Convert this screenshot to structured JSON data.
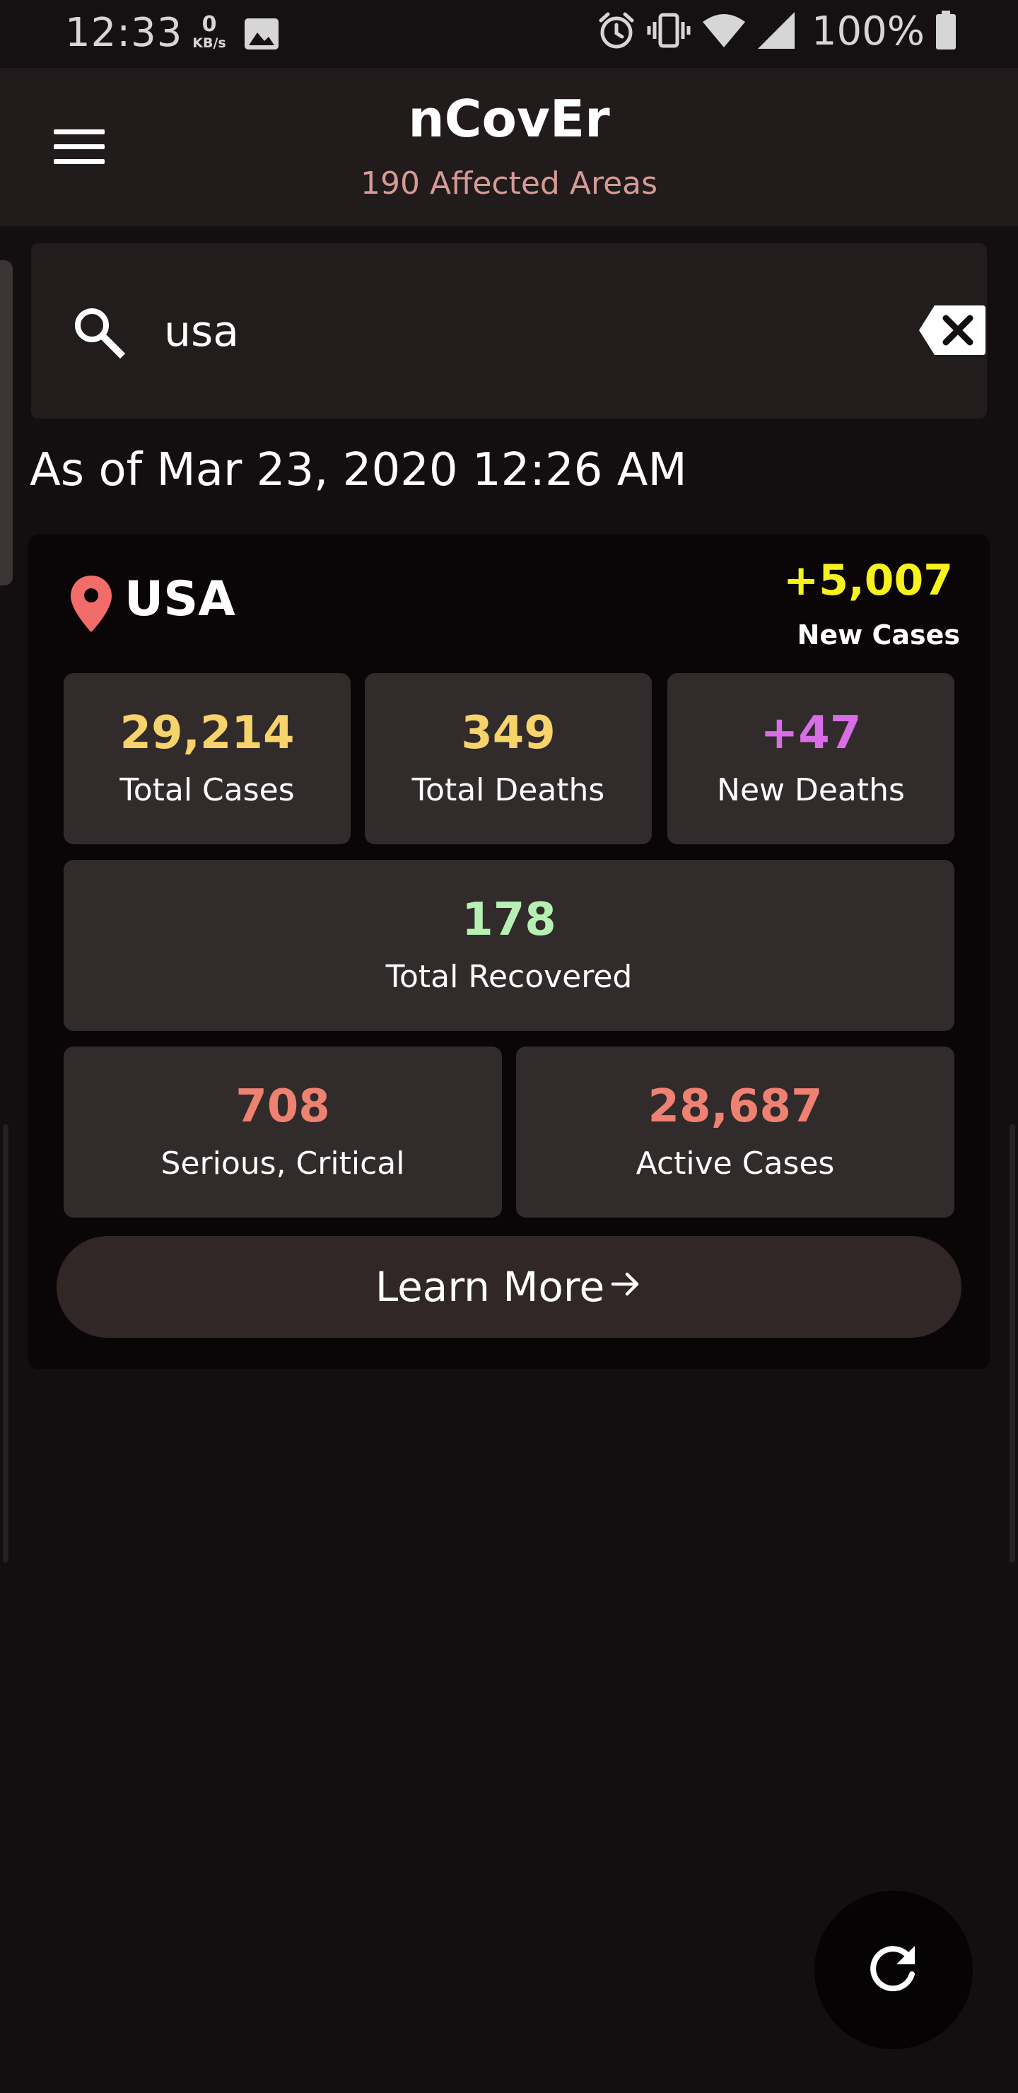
{
  "status_bar": {
    "time": "12:33",
    "net_speed_value": "0",
    "net_speed_unit": "KB/s",
    "battery": "100%",
    "icons": [
      "image-icon",
      "alarm-icon",
      "vibrate-icon",
      "wifi-icon",
      "signal-icon",
      "battery-icon"
    ]
  },
  "app_bar": {
    "title": "nCovEr",
    "subtitle": "190 Affected Areas",
    "menu_icon": "hamburger-menu-icon"
  },
  "search": {
    "value": "usa",
    "icon": "search-icon",
    "clear_icon": "backspace-clear-icon"
  },
  "timestamp": "As of Mar 23, 2020 12:26 AM",
  "country": {
    "name": "USA",
    "pin_icon": "location-pin-icon",
    "new_cases": "+5,007",
    "new_cases_label": "New Cases",
    "stats": {
      "total_cases": {
        "value": "29,214",
        "label": "Total Cases"
      },
      "total_deaths": {
        "value": "349",
        "label": "Total Deaths"
      },
      "new_deaths": {
        "value": "+47",
        "label": "New Deaths"
      },
      "total_recovered": {
        "value": "178",
        "label": "Total Recovered"
      },
      "serious_critical": {
        "value": "708",
        "label": "Serious, Critical"
      },
      "active_cases": {
        "value": "28,687",
        "label": "Active Cases"
      }
    },
    "learn_more": "Learn More"
  },
  "fab": {
    "icon": "refresh-icon"
  },
  "colors": {
    "background": "#130e10",
    "app_bar": "#211b1b",
    "subtitle": "#d59a96",
    "new_cases": "#f5f21d",
    "cases_deaths": "#f7d36b",
    "new_deaths": "#d86ee6",
    "recovered": "#b7f0b4",
    "critical_active": "#ef8172",
    "pin": "#f26d6a",
    "stat_box": "#322b2b"
  }
}
